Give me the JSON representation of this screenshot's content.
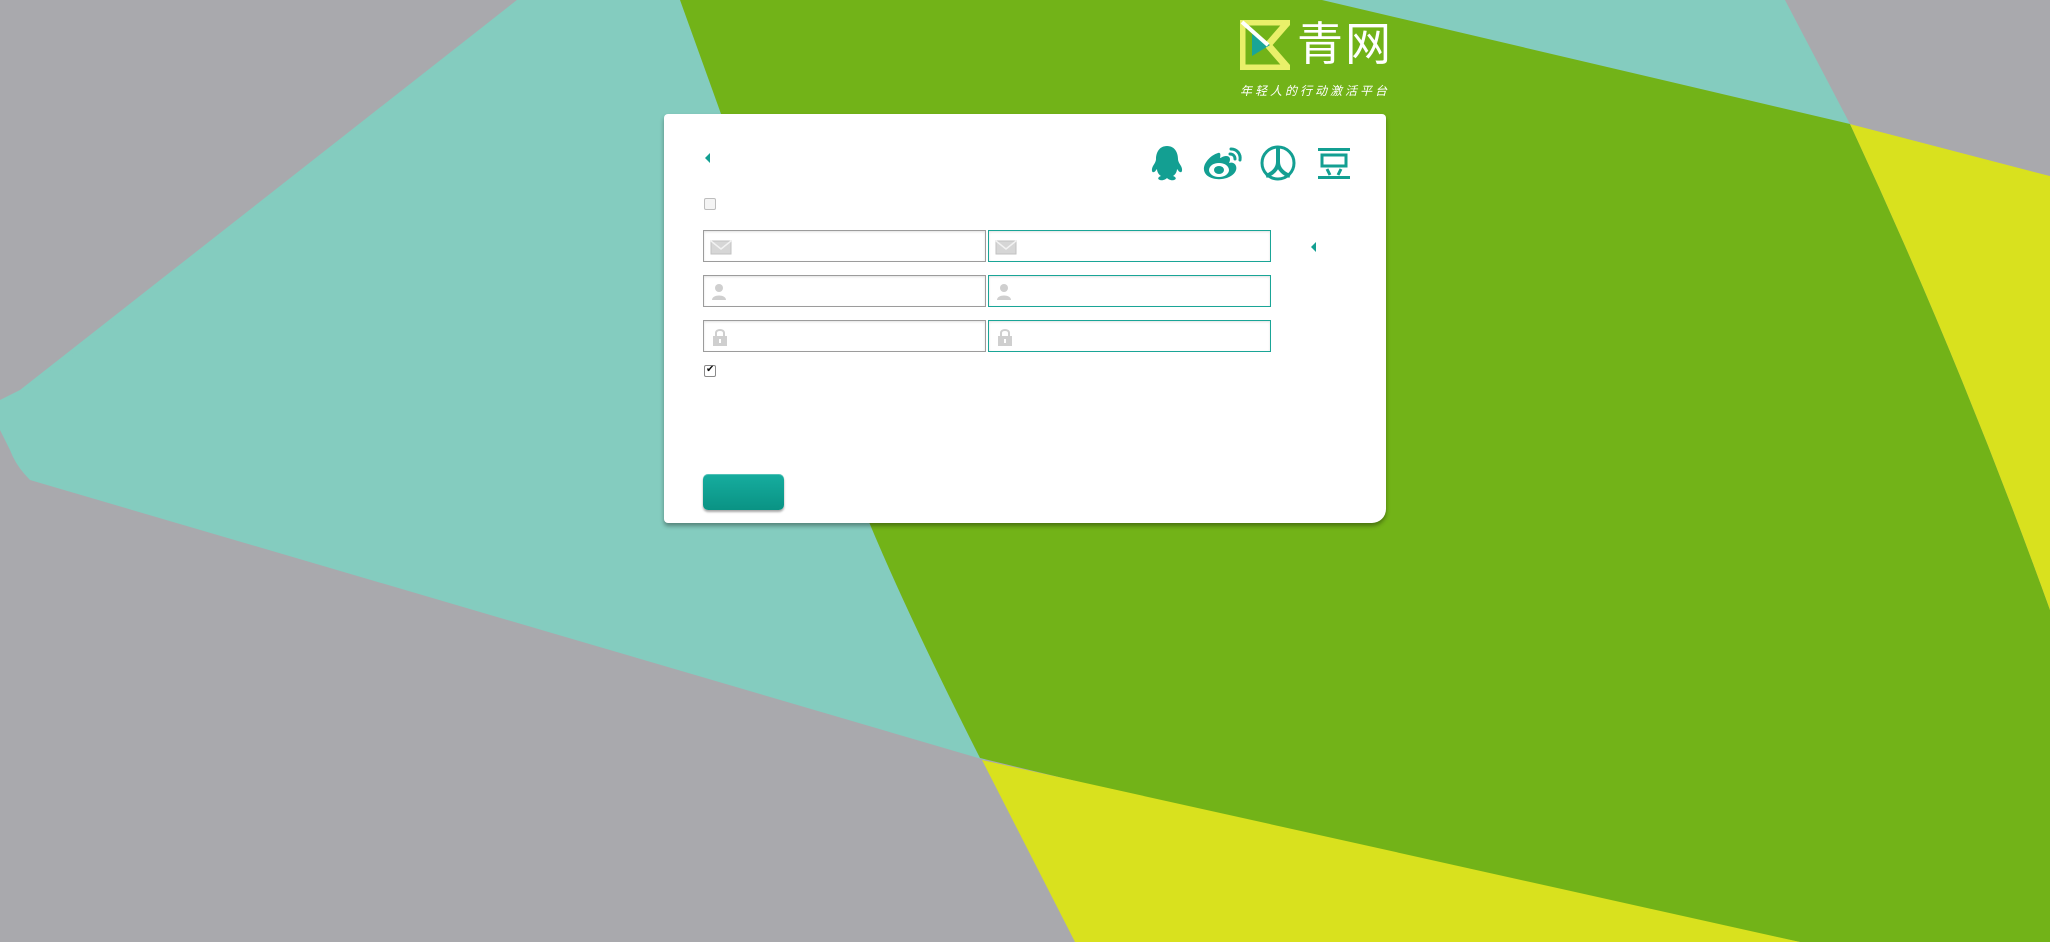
{
  "brand": {
    "name": "青网",
    "tagline": "年轻人的行动激活平台"
  },
  "social_login": [
    {
      "icon": "qq-icon"
    },
    {
      "icon": "weibo-icon"
    },
    {
      "icon": "renren-icon"
    },
    {
      "icon": "douban-icon",
      "glyph": "豆"
    }
  ],
  "form": {
    "left": {
      "email": {
        "icon": "envelope-icon",
        "value": "",
        "placeholder": ""
      },
      "username": {
        "icon": "user-icon",
        "value": "",
        "placeholder": ""
      },
      "password": {
        "icon": "lock-icon",
        "value": "",
        "placeholder": ""
      }
    },
    "right": {
      "email": {
        "icon": "envelope-icon",
        "value": "",
        "placeholder": ""
      },
      "username": {
        "icon": "user-icon",
        "value": "",
        "placeholder": ""
      },
      "password": {
        "icon": "lock-icon",
        "value": "",
        "placeholder": ""
      }
    },
    "remember_checked": true,
    "agree_mark": "✔",
    "submit_label": ""
  },
  "colors": {
    "teal": "#139f92",
    "green": "#72b318",
    "mint": "#84ccbf",
    "yellow": "#d9e11e",
    "grey": "#a9a9ad"
  }
}
